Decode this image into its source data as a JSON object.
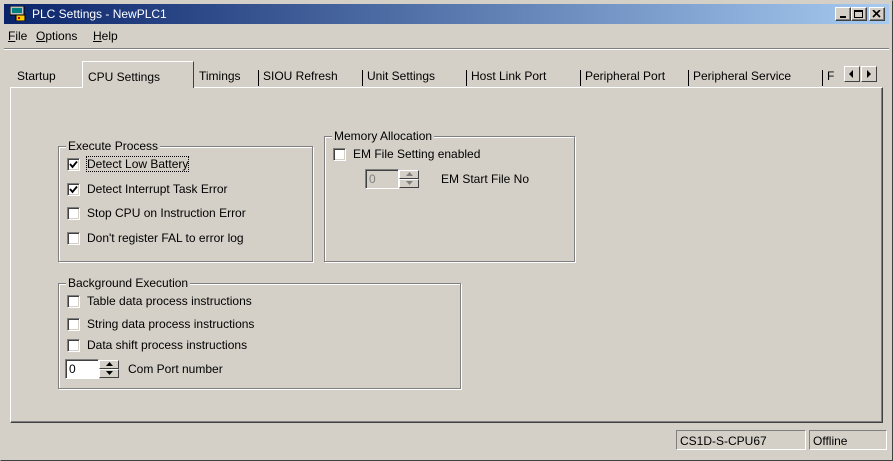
{
  "window": {
    "title": "PLC Settings - NewPLC1",
    "app_icon": "plc-settings-icon",
    "controls": [
      "minimize-icon",
      "maximize-icon",
      "close-icon"
    ]
  },
  "menu": {
    "items": [
      {
        "accel": "F",
        "rest": "ile"
      },
      {
        "accel": "O",
        "rest": "ptions"
      },
      {
        "accel": "H",
        "rest": "elp"
      }
    ]
  },
  "tabs": {
    "items": [
      "Startup",
      "CPU Settings",
      "Timings",
      "SIOU Refresh",
      "Unit Settings",
      "Host Link Port",
      "Peripheral Port",
      "Peripheral Service",
      "F"
    ],
    "active": "CPU Settings",
    "scroll_icons": [
      "scroll-left-icon",
      "scroll-right-icon"
    ]
  },
  "execute_process": {
    "title": "Execute Process",
    "options": [
      {
        "label": "Detect Low Battery",
        "checked": true
      },
      {
        "label": "Detect Interrupt Task Error",
        "checked": true
      },
      {
        "label": "Stop CPU on Instruction Error",
        "checked": false
      },
      {
        "label": "Don't register FAL to error log",
        "checked": false
      }
    ]
  },
  "memory_allocation": {
    "title": "Memory Allocation",
    "em_file_label": "EM File Setting enabled",
    "em_file_checked": false,
    "em_start_value": "0",
    "em_start_label": "EM Start File No"
  },
  "background_execution": {
    "title": "Background Execution",
    "options": [
      {
        "label": "Table data process instructions",
        "checked": false
      },
      {
        "label": "String data process instructions",
        "checked": false
      },
      {
        "label": "Data shift process instructions",
        "checked": false
      }
    ],
    "com_port_value": "0",
    "com_port_label": "Com Port number"
  },
  "status_bar": {
    "cpu_model": "CS1D-S-CPU67",
    "state": "Offline"
  }
}
